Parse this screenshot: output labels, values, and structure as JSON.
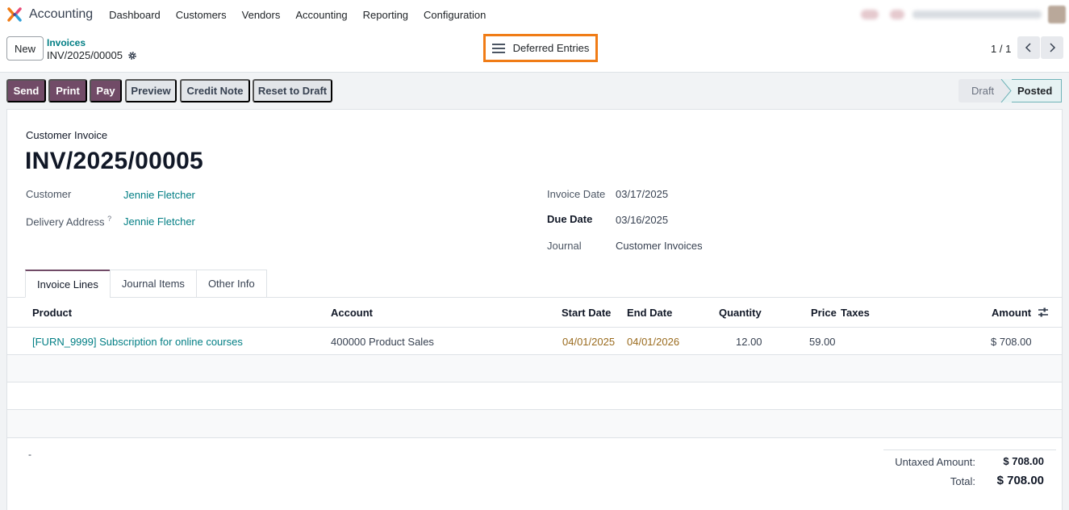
{
  "nav": {
    "app_name": "Accounting",
    "menu": [
      "Dashboard",
      "Customers",
      "Vendors",
      "Accounting",
      "Reporting",
      "Configuration"
    ]
  },
  "control_panel": {
    "new_label": "New",
    "breadcrumb_parent": "Invoices",
    "breadcrumb_current": "INV/2025/00005",
    "deferred_label": "Deferred Entries",
    "pager": "1 / 1"
  },
  "actions": {
    "send": "Send",
    "print": "Print",
    "pay": "Pay",
    "preview": "Preview",
    "credit_note": "Credit Note",
    "reset_to_draft": "Reset to Draft"
  },
  "status": {
    "draft": "Draft",
    "posted": "Posted"
  },
  "invoice": {
    "type": "Customer Invoice",
    "name": "INV/2025/00005",
    "customer_label": "Customer",
    "customer": "Jennie Fletcher",
    "delivery_label": "Delivery Address",
    "delivery_help": "?",
    "delivery": "Jennie Fletcher",
    "invoice_date_label": "Invoice Date",
    "invoice_date": "03/17/2025",
    "due_date_label": "Due Date",
    "due_date": "03/16/2025",
    "journal_label": "Journal",
    "journal": "Customer Invoices"
  },
  "tabs": [
    "Invoice Lines",
    "Journal Items",
    "Other Info"
  ],
  "table": {
    "headers": {
      "product": "Product",
      "account": "Account",
      "start_date": "Start Date",
      "end_date": "End Date",
      "quantity": "Quantity",
      "price": "Price",
      "taxes": "Taxes",
      "amount": "Amount"
    },
    "rows": [
      {
        "product": "[FURN_9999] Subscription for online courses",
        "account": "400000 Product Sales",
        "start_date": "04/01/2025",
        "end_date": "04/01/2026",
        "quantity": "12.00",
        "price": "59.00",
        "taxes": "",
        "amount": "$ 708.00"
      }
    ]
  },
  "totals": {
    "dash": "-",
    "untaxed_label": "Untaxed Amount:",
    "untaxed_value": "$ 708.00",
    "total_label": "Total:",
    "total_value": "$ 708.00"
  },
  "colors": {
    "brand": "#714b67",
    "link": "#017e84",
    "highlight": "#f07c16",
    "date": "#9a6b1e"
  }
}
